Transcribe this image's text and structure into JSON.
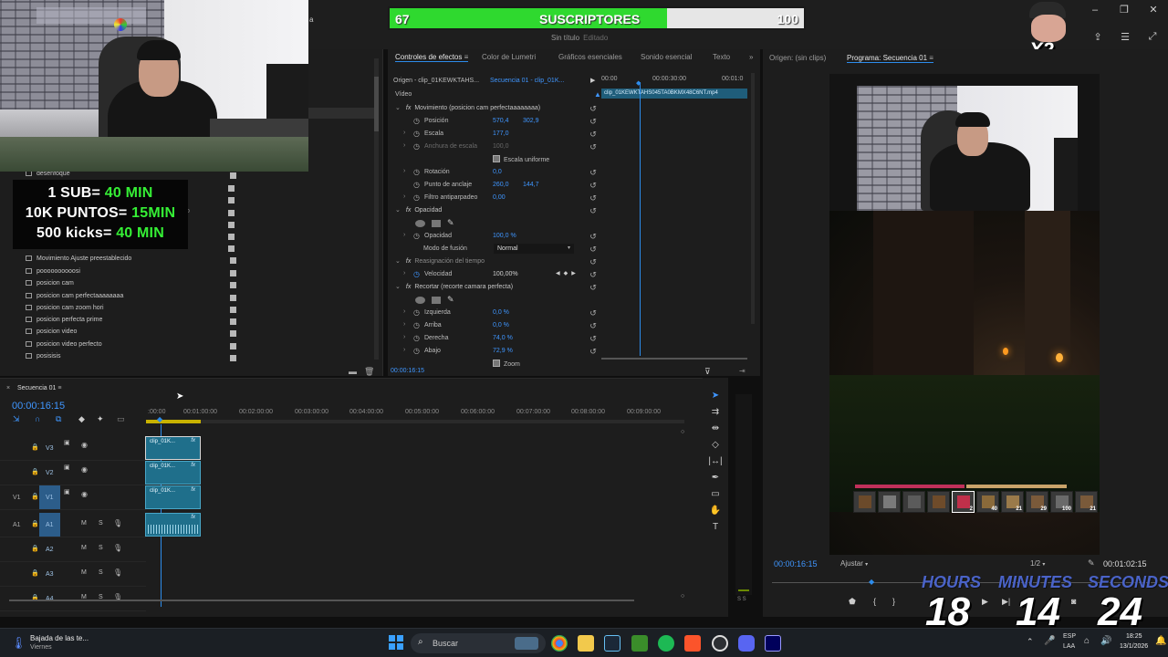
{
  "app": {
    "document_title": "Sin título",
    "document_state": "Editado",
    "stray_char": "a"
  },
  "sub_goal": {
    "current": "67",
    "label": "SUSCRIPTORES",
    "goal": "100",
    "progress": 0.67
  },
  "overlay_stats": {
    "line1_a": "1 SUB= ",
    "line1_b": "40 MIN",
    "line2_a": "10K PUNTOS= ",
    "line2_b": "15MIN",
    "line3_a": "500 kicks= ",
    "line3_b": "40 MIN"
  },
  "avatar_badge": "X2",
  "effects_list": {
    "items": [
      "desenfoque",
      "Movimiento Ajuste preestablecido",
      "poooooooooosi",
      "posicion cam",
      "posicion cam perfectaaaaaaaa",
      "posicion cam zoom hori",
      "posicion perfecta prime",
      "posicion video",
      "posicion video perfecto",
      "posisisis"
    ],
    "partial_text": "o"
  },
  "effect_controls": {
    "tabs": [
      "Controles de efectos",
      "Color de Lumetri",
      "Gráficos esenciales",
      "Sonido esencial",
      "Texto"
    ],
    "source": "Origen - clip_01KEWKTAHS...",
    "sequence": "Secuencia 01 - clip_01K...",
    "section_video": "Vídeo",
    "motion_header": "Movimiento (posicion cam perfectaaaaaaaa)",
    "props": {
      "posicion": {
        "name": "Posición",
        "x": "570,4",
        "y": "302,9"
      },
      "escala": {
        "name": "Escala",
        "v": "177,0"
      },
      "anchura": {
        "name": "Anchura de escala",
        "v": "100,0"
      },
      "uniforme": "Escala uniforme",
      "rotacion": {
        "name": "Rotación",
        "v": "0,0"
      },
      "anclaje": {
        "name": "Punto de anclaje",
        "x": "260,0",
        "y": "144,7"
      },
      "antiparpadeo": {
        "name": "Filtro antiparpadeo",
        "v": "0,00"
      },
      "opacidad_header": "Opacidad",
      "opacidad": {
        "name": "Opacidad",
        "v": "100,0 %"
      },
      "modo": {
        "name": "Modo de fusión",
        "v": "Normal"
      },
      "reasignacion": "Reasignación del tiempo",
      "velocidad": {
        "name": "Velocidad",
        "v": "100,00%"
      },
      "recortar_header": "Recortar (recorte camara perfecta)",
      "izquierda": {
        "name": "Izquierda",
        "v": "0,0 %"
      },
      "arriba": {
        "name": "Arriba",
        "v": "0,0 %"
      },
      "derecha": {
        "name": "Derecha",
        "v": "74,0 %"
      },
      "abajo": {
        "name": "Abajo",
        "v": "72,9 %"
      },
      "zoom": "Zoom"
    },
    "mini_timeline": {
      "t0": "00:00",
      "t1": "00:00:30:00",
      "t2": "00:01:0",
      "clip": "clip_01KEWKTAHS045TA0BKMX48C6NT.mp4"
    },
    "timecode": "00:00:16:15"
  },
  "program_monitor": {
    "origin_tab": "Origen: (sin clips)",
    "program_tab": "Programa: Secuencia 01",
    "timecode": "00:00:16:15",
    "fit": "Ajustar",
    "resolution": "1/2",
    "duration": "00:01:02:15",
    "hotbar": [
      "",
      "",
      "",
      "",
      "2",
      "40",
      "21",
      "29",
      "100",
      "21"
    ]
  },
  "timeline": {
    "tab": "Secuencia 01",
    "timecode": "00:00:16:15",
    "ruler": [
      ":00:00",
      "00:01:00:00",
      "00:02:00:00",
      "00:03:00:00",
      "00:04:00:00",
      "00:05:00:00",
      "00:06:00:00",
      "00:07:00:00",
      "00:08:00:00",
      "00:09:00:00"
    ],
    "tracks": [
      {
        "src": "",
        "name": "V3"
      },
      {
        "src": "",
        "name": "V2"
      },
      {
        "src": "V1",
        "name": "V1"
      },
      {
        "src": "A1",
        "name": "A1"
      },
      {
        "src": "",
        "name": "A2"
      },
      {
        "src": "",
        "name": "A3"
      },
      {
        "src": "",
        "name": "A4"
      }
    ],
    "clip_label": "clip_01K..."
  },
  "countdown": {
    "hours_label": "HOURS",
    "minutes_label": "MINUTES",
    "seconds_label": "SECONDS",
    "hours": "18",
    "minutes": "14",
    "seconds": "24"
  },
  "taskbar": {
    "weather_title": "Bajada de las te...",
    "weather_sub": "Viernes",
    "search": "Buscar",
    "lang": "ESP",
    "region": "LAA",
    "time": "18:25",
    "date": "13/1/2026"
  },
  "colors": {
    "accent_blue": "#2d8ceb",
    "clip_teal": "#1f6f8b",
    "goal_green": "#2fd92f",
    "stats_green": "#35ef35",
    "countdown_blue": "#4a63c8"
  }
}
